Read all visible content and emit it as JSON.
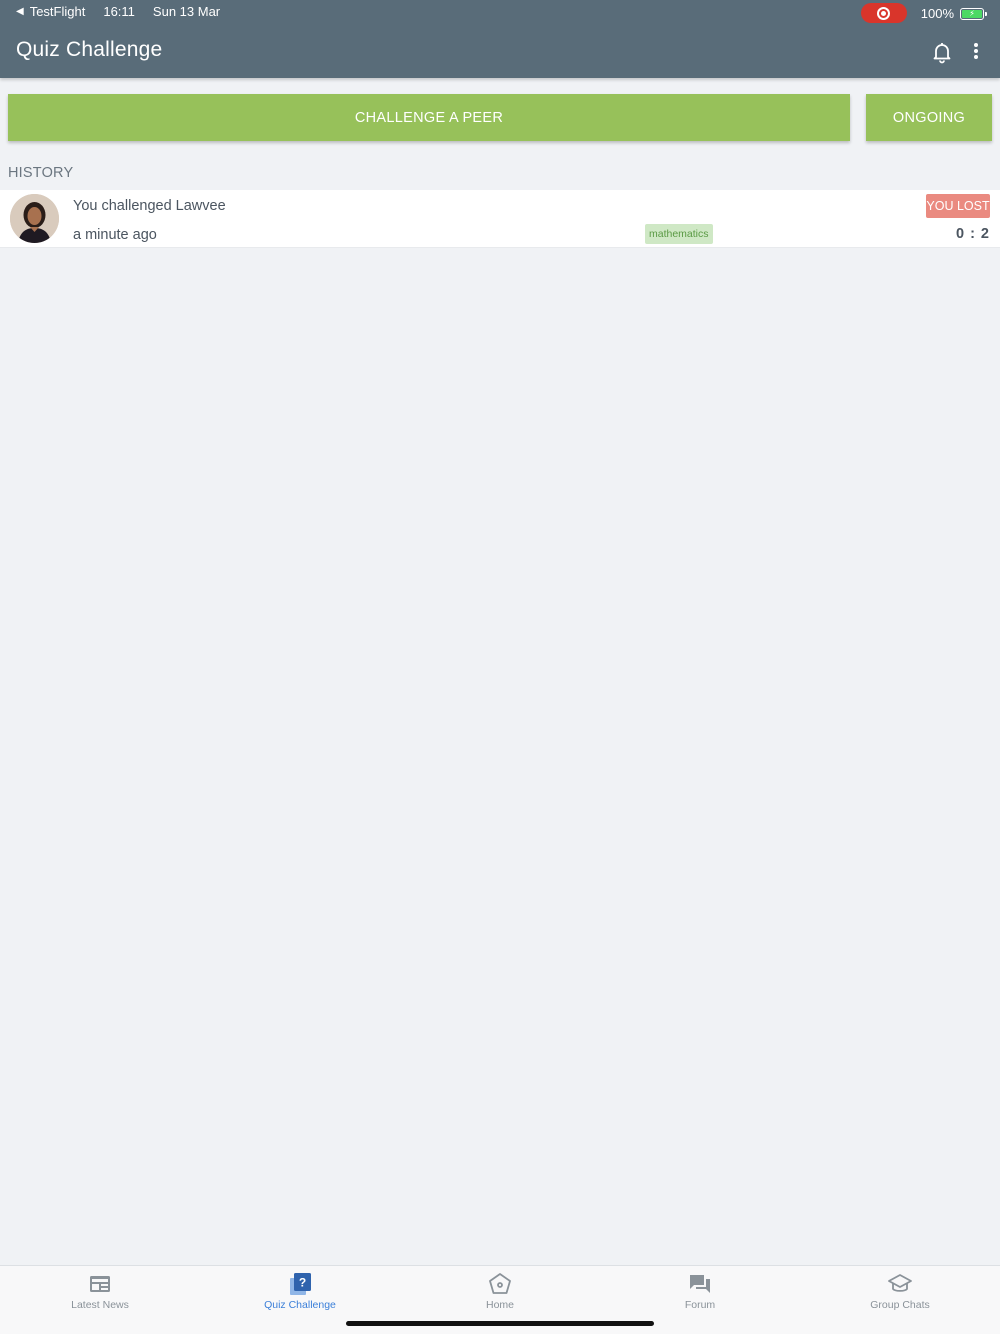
{
  "status_bar": {
    "back_app": "TestFlight",
    "time": "16:11",
    "date": "Sun 13 Mar",
    "battery": "100%"
  },
  "header": {
    "title": "Quiz Challenge"
  },
  "actions": {
    "challenge_label": "CHALLENGE A PEER",
    "ongoing_label": "ONGOING"
  },
  "history": {
    "section_label": "HISTORY",
    "items": [
      {
        "title": "You challenged Lawvee",
        "time": "a minute ago",
        "subject": "mathematics",
        "result": "YOU LOST",
        "score": "0 : 2"
      }
    ]
  },
  "tabs": [
    {
      "label": "Latest News",
      "icon": "newspaper-icon",
      "active": false
    },
    {
      "label": "Quiz Challenge",
      "icon": "quiz-icon",
      "active": true
    },
    {
      "label": "Home",
      "icon": "home-icon",
      "active": false
    },
    {
      "label": "Forum",
      "icon": "forum-icon",
      "active": false
    },
    {
      "label": "Group Chats",
      "icon": "graduation-cap-icon",
      "active": false
    }
  ],
  "colors": {
    "header_bg": "#596c79",
    "button_green": "#97c15a",
    "lost_badge": "#ea8a80",
    "tag_bg": "#cfe8c5",
    "active_tab": "#3b7fd9",
    "record_red": "#d9352b"
  }
}
